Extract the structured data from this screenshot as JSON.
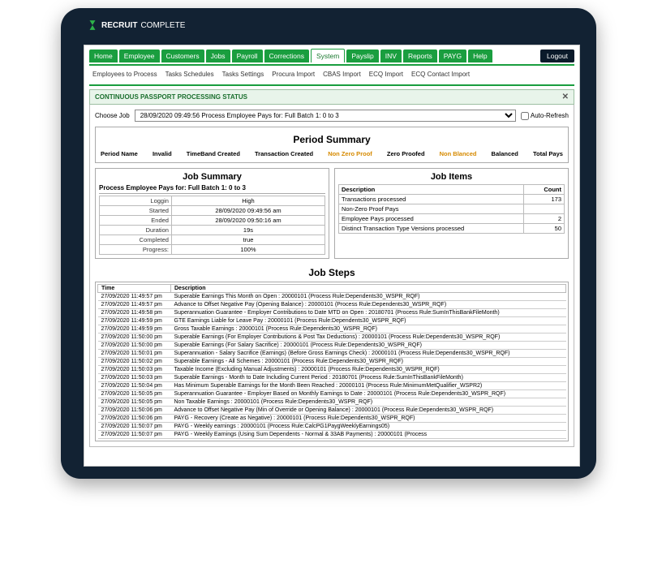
{
  "brand": {
    "name": "RECRUIT",
    "sub": "COMPLETE"
  },
  "mainNav": {
    "tabs": [
      "Home",
      "Employee",
      "Customers",
      "Jobs",
      "Payroll",
      "Corrections",
      "System",
      "Payslip",
      "INV",
      "Reports",
      "PAYG",
      "Help"
    ],
    "active": "System",
    "logout": "Logout"
  },
  "subNav": [
    "Employees to Process",
    "Tasks Schedules",
    "Tasks Settings",
    "Procura Import",
    "CBAS Import",
    "ECQ Import",
    "ECQ Contact Import"
  ],
  "panelTitle": "CONTINUOUS PASSPORT PROCESSING STATUS",
  "chooseJobLabel": "Choose Job",
  "jobSelectValue": "28/09/2020 09:49:56 Process Employee Pays for: Full Batch 1: 0 to 3",
  "autoRefreshLabel": "Auto-Refresh",
  "sections": {
    "periodSummary": "Period Summary",
    "jobSummary": "Job Summary",
    "jobItems": "Job Items",
    "jobSteps": "Job Steps"
  },
  "periodCols": [
    {
      "label": "Period Name",
      "orange": false
    },
    {
      "label": "Invalid",
      "orange": false
    },
    {
      "label": "TimeBand Created",
      "orange": false
    },
    {
      "label": "Transaction Created",
      "orange": false
    },
    {
      "label": "Non Zero Proof",
      "orange": true
    },
    {
      "label": "Zero Proofed",
      "orange": false
    },
    {
      "label": "Non Blanced",
      "orange": true
    },
    {
      "label": "Balanced",
      "orange": false
    },
    {
      "label": "Total Pays",
      "orange": false
    }
  ],
  "jobSummaryTitle": "Process Employee Pays for: Full Batch 1: 0 to 3",
  "jobSummaryRows": [
    {
      "k": "Loggin",
      "v": "High"
    },
    {
      "k": "Started",
      "v": "28/09/2020 09:49:56 am"
    },
    {
      "k": "Ended",
      "v": "28/09/2020 09:50:16 am"
    },
    {
      "k": "Duration",
      "v": "19s"
    },
    {
      "k": "Completed",
      "v": "true"
    },
    {
      "k": "Progress:",
      "v": "100%"
    }
  ],
  "jobItemsHeader": {
    "desc": "Description",
    "count": "Count"
  },
  "jobItemsRows": [
    {
      "desc": "Transactions processed",
      "count": "173"
    },
    {
      "desc": "Non-Zero Proof Pays",
      "count": ""
    },
    {
      "desc": "Employee Pays processed",
      "count": "2"
    },
    {
      "desc": "Distinct Transaction Type Versions processed",
      "count": "50"
    }
  ],
  "stepsHeader": {
    "time": "Time",
    "desc": "Description"
  },
  "stepsRows": [
    {
      "t": "27/09/2020 11:49:57 pm",
      "d": "Superable Earnings This Month on Open : 20000101 (Process Rule:Dependents30_WSPR_RQF)"
    },
    {
      "t": "27/09/2020 11:49:57 pm",
      "d": "Advance to Offset Negative Pay (Opening Balance) : 20000101 (Process Rule:Dependents30_WSPR_RQF)"
    },
    {
      "t": "27/09/2020 11:49:58 pm",
      "d": "Superannuation Guarantee - Employer Contributions to Date MTD on Open : 20180701 (Process Rule:SumInThisBankFileMonth)"
    },
    {
      "t": "27/09/2020 11:49:59 pm",
      "d": "GTE Earnings Liable for Leave Pay : 20000101 (Process Rule:Dependents30_WSPR_RQF)"
    },
    {
      "t": "27/09/2020 11:49:59 pm",
      "d": "Gross Taxable Earnings : 20000101 (Process Rule:Dependents30_WSPR_RQF)"
    },
    {
      "t": "27/09/2020 11:50:00 pm",
      "d": "Superable Earnings (For Employer Contributions & Post Tax Deductions) : 20000101 (Process Rule:Dependents30_WSPR_RQF)"
    },
    {
      "t": "27/09/2020 11:50:00 pm",
      "d": "Superable Earnings (For Salary Sacrifice) : 20000101 (Process Rule:Dependents30_WSPR_RQF)"
    },
    {
      "t": "27/09/2020 11:50:01 pm",
      "d": "Superannuation - Salary Sacrifice (Earnings) (Before Gross Earnings Check) : 20000101 (Process Rule:Dependents30_WSPR_RQF)"
    },
    {
      "t": "27/09/2020 11:50:02 pm",
      "d": "Superable Earnings - All Schemes : 20000101 (Process Rule:Dependents30_WSPR_RQF)"
    },
    {
      "t": "27/09/2020 11:50:03 pm",
      "d": "Taxable Income (Excluding Manual Adjustments) : 20000101 (Process Rule:Dependents30_WSPR_RQF)"
    },
    {
      "t": "27/09/2020 11:50:03 pm",
      "d": "Superable Earnings - Month to Date Including Current Period : 20180701 (Process Rule:SumInThisBankFileMonth)"
    },
    {
      "t": "27/09/2020 11:50:04 pm",
      "d": "Has Minimum Superable Earnings for the Month Been Reached : 20000101 (Process Rule:MinimumMetQualifier_WSPR2)"
    },
    {
      "t": "27/09/2020 11:50:05 pm",
      "d": "Superannuation Guarantee - Employer Based on Monthly Earnings to Date : 20000101 (Process Rule:Dependents30_WSPR_RQF)"
    },
    {
      "t": "27/09/2020 11:50:05 pm",
      "d": "Non Taxable Earnings : 20000101 (Process Rule:Dependents30_WSPR_RQF)"
    },
    {
      "t": "27/09/2020 11:50:06 pm",
      "d": "Advance to Offset Negative Pay (Min of Override or Opening Balance) : 20000101 (Process Rule:Dependents30_WSPR_RQF)"
    },
    {
      "t": "27/09/2020 11:50:06 pm",
      "d": "PAYG - Recovery (Create as Negative) : 20000101 (Process Rule:Dependents30_WSPR_RQF)"
    },
    {
      "t": "27/09/2020 11:50:07 pm",
      "d": "PAYG - Weekly earnings : 20000101 (Process Rule:CalcPG1PaygWeeklyEarnings05)"
    },
    {
      "t": "27/09/2020 11:50:07 pm",
      "d": "PAYG - Weekly Earnings (Using Sum Dependents - Normal & 33AB Payments) : 20000101 (Process"
    }
  ]
}
